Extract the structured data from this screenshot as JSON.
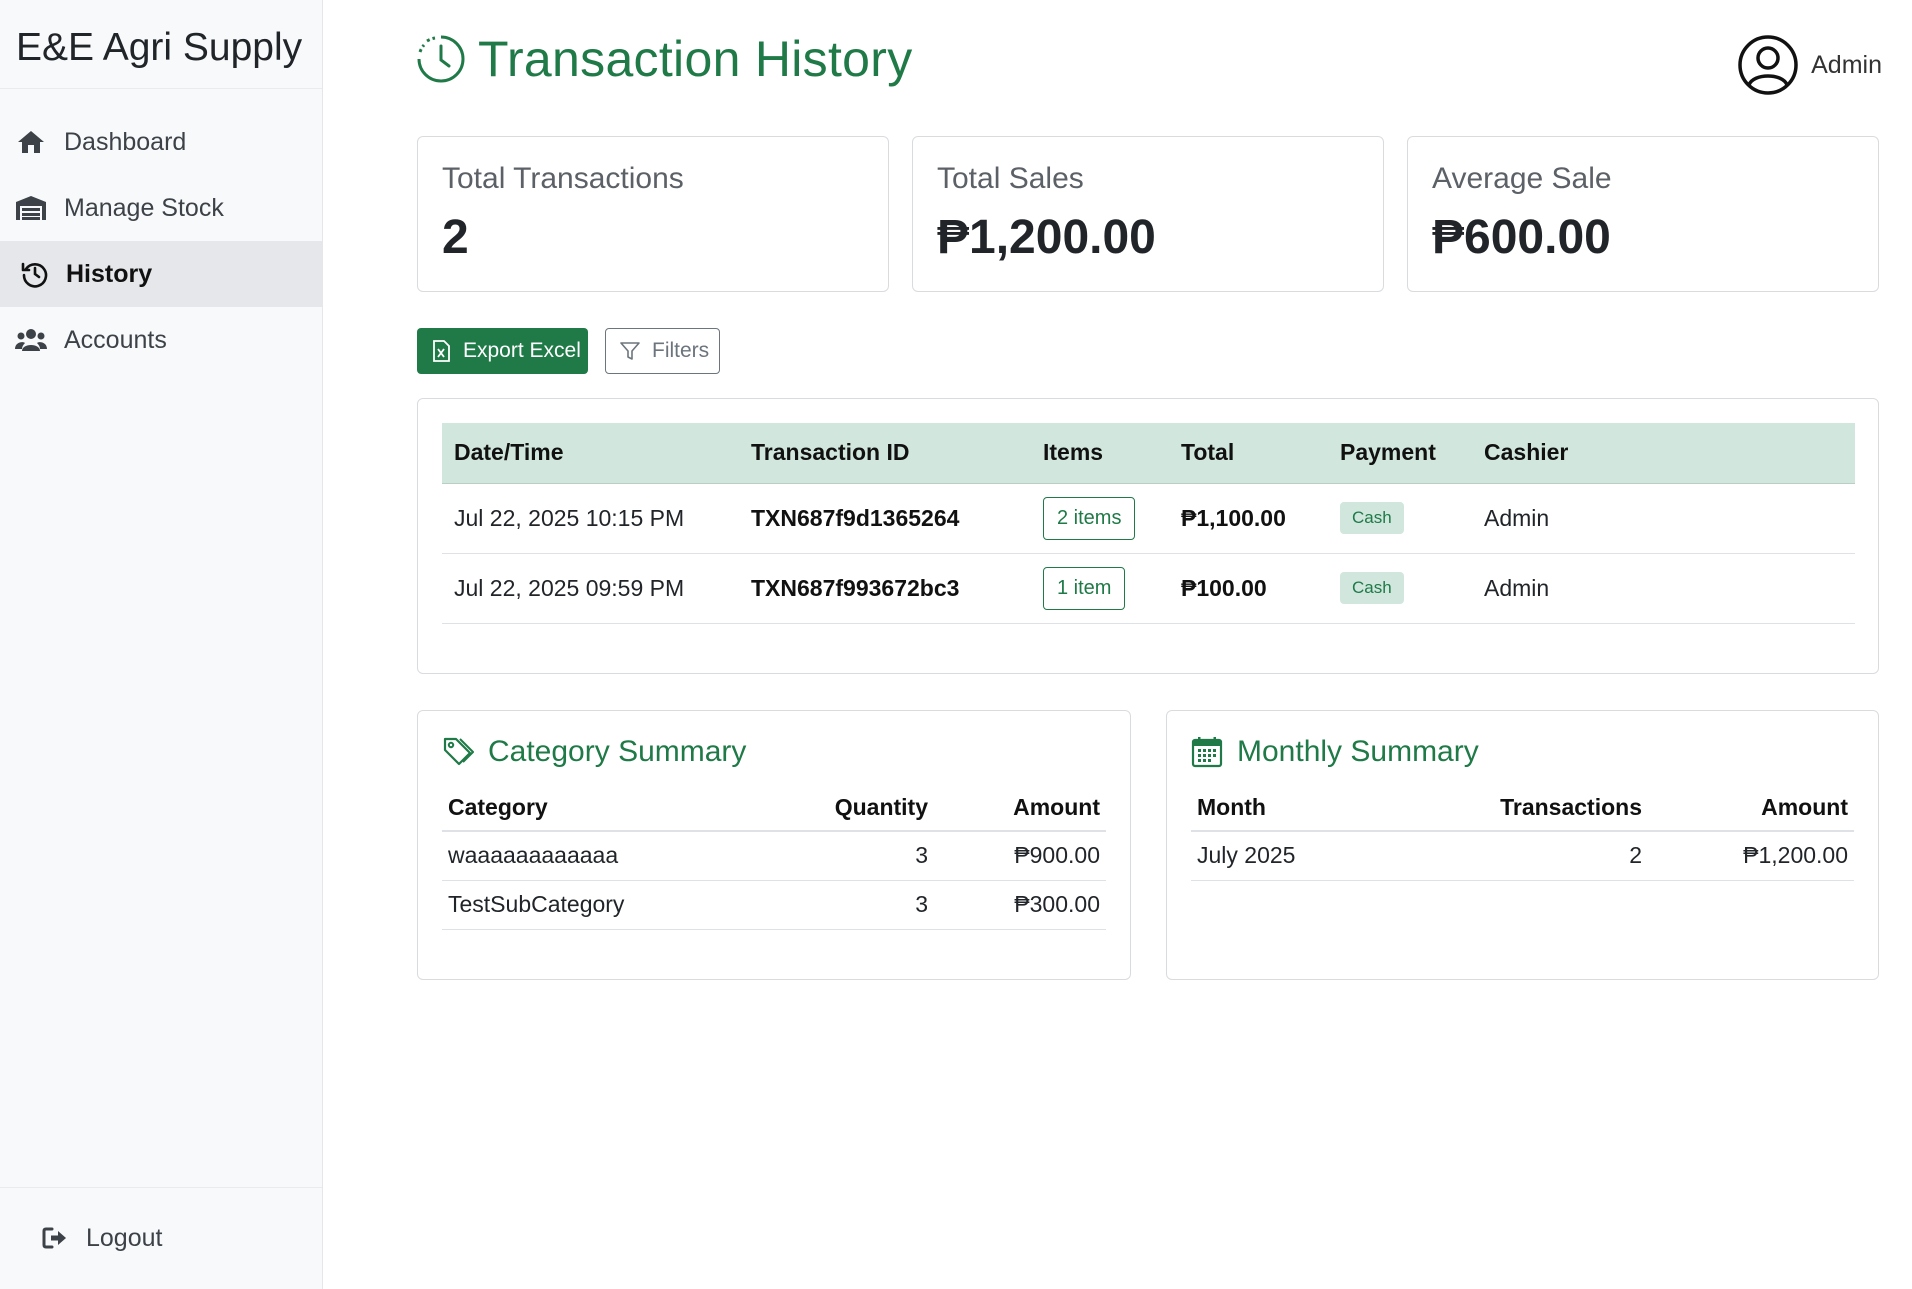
{
  "app": {
    "brand": "E&E Agri Supply"
  },
  "sidebar": {
    "items": [
      {
        "label": "Dashboard",
        "icon": "home-icon"
      },
      {
        "label": "Manage Stock",
        "icon": "warehouse-icon"
      },
      {
        "label": "History",
        "icon": "history-icon",
        "active": true
      },
      {
        "label": "Accounts",
        "icon": "users-icon"
      }
    ],
    "logout": "Logout"
  },
  "header": {
    "title": "Transaction History",
    "user": "Admin"
  },
  "stats": [
    {
      "label": "Total Transactions",
      "value": "2"
    },
    {
      "label": "Total Sales",
      "value": "₱1,200.00"
    },
    {
      "label": "Average Sale",
      "value": "₱600.00"
    }
  ],
  "toolbar": {
    "export_label": "Export Excel",
    "filters_label": "Filters"
  },
  "transactions": {
    "columns": [
      "Date/Time",
      "Transaction ID",
      "Items",
      "Total",
      "Payment",
      "Cashier"
    ],
    "rows": [
      {
        "datetime": "Jul 22, 2025 10:15 PM",
        "id": "TXN687f9d1365264",
        "items": "2 items",
        "total": "₱1,100.00",
        "payment": "Cash",
        "cashier": "Admin"
      },
      {
        "datetime": "Jul 22, 2025 09:59 PM",
        "id": "TXN687f993672bc3",
        "items": "1 item",
        "total": "₱100.00",
        "payment": "Cash",
        "cashier": "Admin"
      }
    ]
  },
  "category_summary": {
    "title": "Category Summary",
    "columns": [
      "Category",
      "Quantity",
      "Amount"
    ],
    "rows": [
      {
        "category": "waaaaaaaaaaaa",
        "quantity": "3",
        "amount": "₱900.00"
      },
      {
        "category": "TestSubCategory",
        "quantity": "3",
        "amount": "₱300.00"
      }
    ]
  },
  "monthly_summary": {
    "title": "Monthly Summary",
    "columns": [
      "Month",
      "Transactions",
      "Amount"
    ],
    "rows": [
      {
        "month": "July 2025",
        "transactions": "2",
        "amount": "₱1,200.00"
      }
    ]
  },
  "colors": {
    "accent": "#1f7a48",
    "table_header": "#d1e7dd",
    "sidebar_bg": "#f8f9fa"
  }
}
